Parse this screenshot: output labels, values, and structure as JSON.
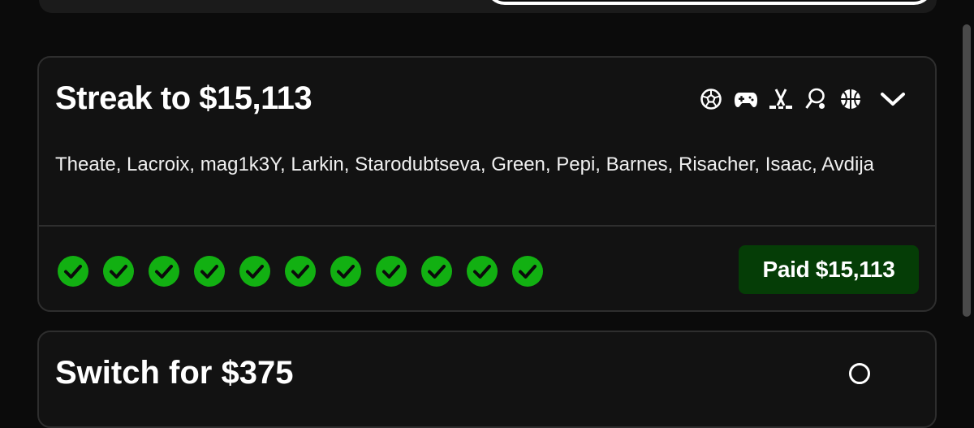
{
  "card": {
    "title": "Streak to $15,113",
    "players": "Theate, Lacroix, mag1k3Y, Larkin, Starodubtseva, Green, Pepi, Barnes, Risacher, Isaac, Avdija",
    "sport_icons": [
      "soccer-ball-icon",
      "gamepad-icon",
      "hockey-sticks-icon",
      "tennis-racket-icon",
      "basketball-icon"
    ],
    "checks_count": 11,
    "paid_label": "Paid $15,113"
  },
  "next_card": {
    "title": "Switch for $375"
  },
  "colors": {
    "background": "#0b0b0b",
    "card": "#121212",
    "check_green": "#12b012",
    "paid_bg": "#053d06"
  }
}
